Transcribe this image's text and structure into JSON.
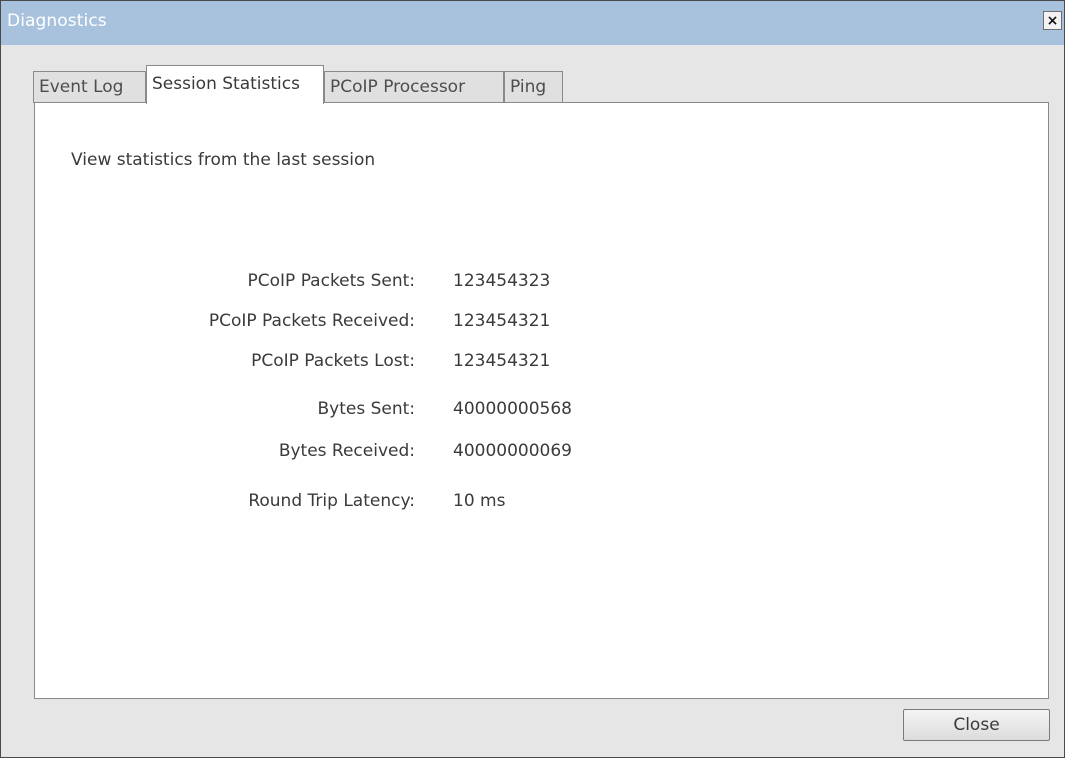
{
  "window": {
    "title": "Diagnostics",
    "close_glyph": "×"
  },
  "tabs": [
    {
      "label": "Event Log",
      "active": false
    },
    {
      "label": "Session Statistics",
      "active": true
    },
    {
      "label": "PCoIP Processor",
      "active": false
    },
    {
      "label": "Ping",
      "active": false
    }
  ],
  "panel": {
    "intro": "View statistics from the last session",
    "stats": [
      {
        "label": "PCoIP Packets Sent:",
        "value": "123454323"
      },
      {
        "label": "PCoIP Packets Received:",
        "value": "123454321"
      },
      {
        "label": "PCoIP Packets Lost:",
        "value": "123454321"
      },
      {
        "label": "Bytes Sent:",
        "value": "40000000568"
      },
      {
        "label": "Bytes Received:",
        "value": "40000000069"
      },
      {
        "label": "Round Trip Latency:",
        "value": "10 ms"
      }
    ]
  },
  "footer": {
    "close_label": "Close"
  },
  "colors": {
    "title_bar": "#a8c2de",
    "window_bg": "#e6e6e6",
    "panel_bg": "#ffffff",
    "text": "#3a3a3a"
  }
}
